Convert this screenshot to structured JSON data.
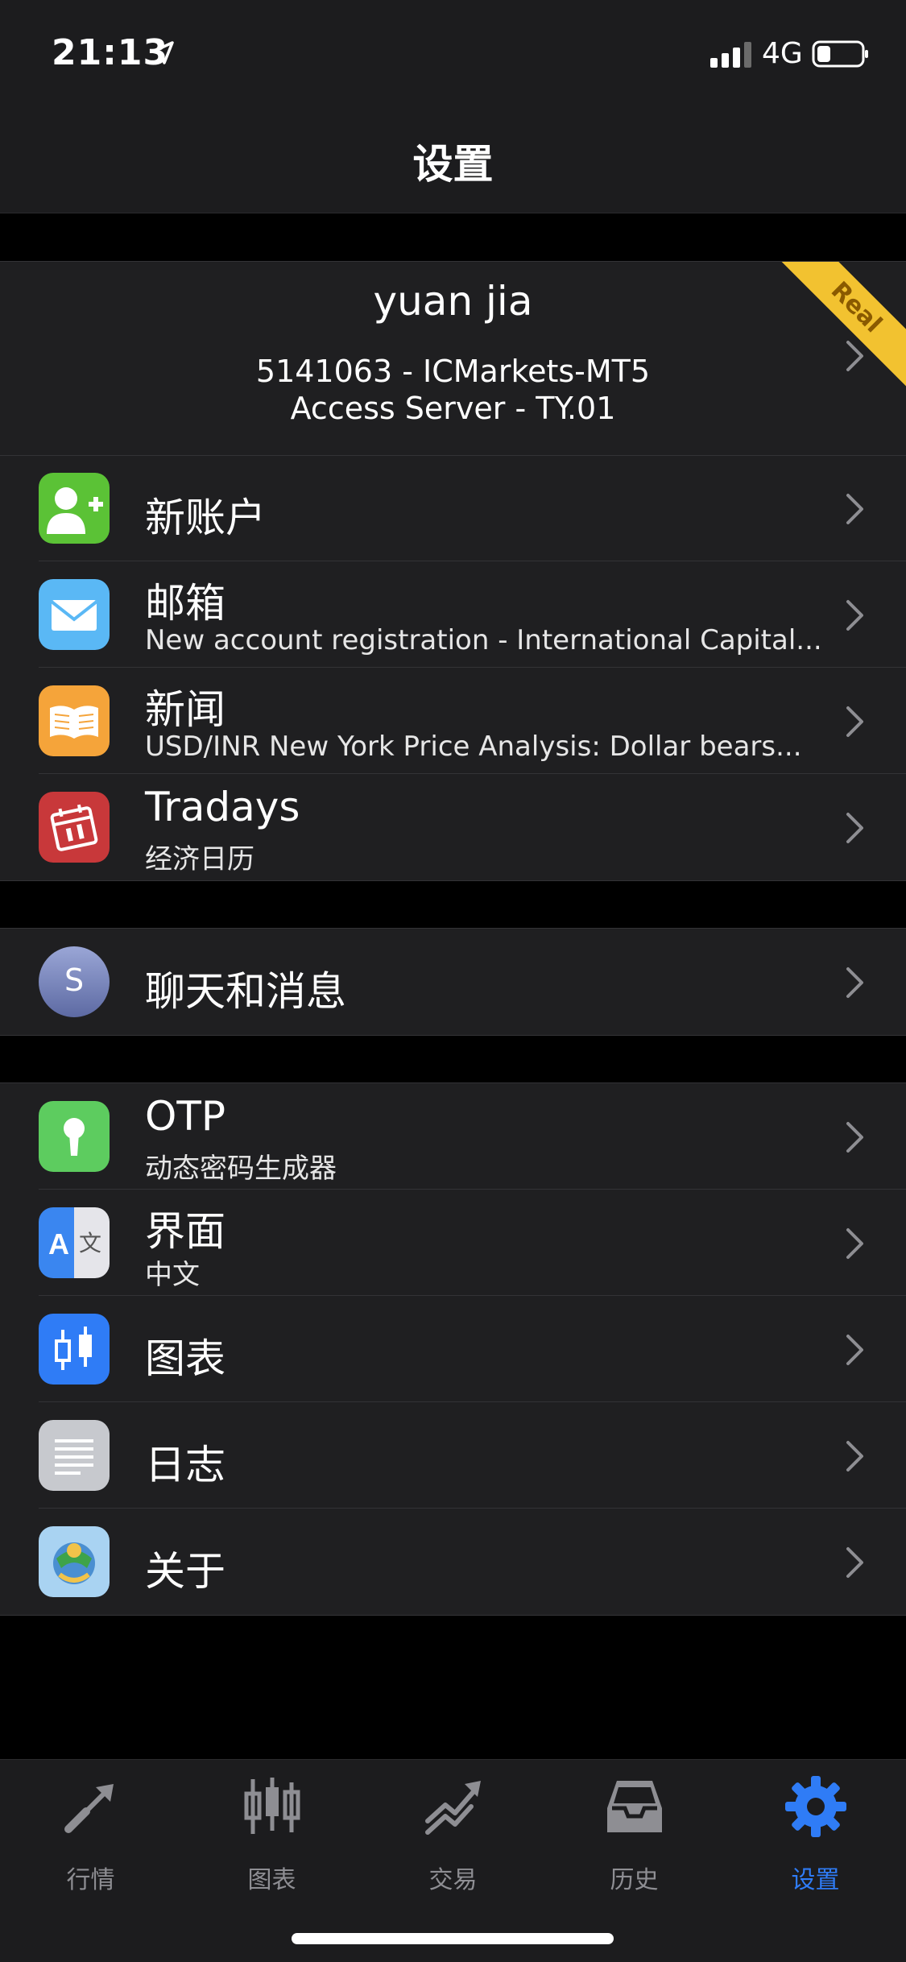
{
  "status": {
    "time": "21:13",
    "network": "4G"
  },
  "nav": {
    "title": "设置"
  },
  "account": {
    "name": "yuan jia",
    "line1": "5141063 - ICMarkets-MT5",
    "line2": "Access Server - TY.01",
    "badge": "Real"
  },
  "group1": [
    {
      "title": "新账户",
      "subtitle": "",
      "icon": "add-user-icon",
      "color": "#5bc236"
    },
    {
      "title": "邮箱",
      "subtitle": "New account registration - International Capital...",
      "icon": "mail-icon",
      "color": "#5ab8f5"
    },
    {
      "title": "新闻",
      "subtitle": "USD/INR New York Price Analysis: Dollar bears...",
      "icon": "book-icon",
      "color": "#f5a43a"
    },
    {
      "title": "Tradays",
      "subtitle": "经济日历",
      "icon": "calendar-icon",
      "color": "#c8383a"
    }
  ],
  "chat": {
    "title": "聊天和消息",
    "avatar_letter": "S"
  },
  "group3": [
    {
      "title": "OTP",
      "subtitle": "动态密码生成器",
      "icon": "key-icon",
      "color": "#5dcc5f"
    },
    {
      "title": "界面",
      "subtitle": "中文",
      "icon": "translate-icon",
      "color": "#3a86f0"
    },
    {
      "title": "图表",
      "subtitle": "",
      "icon": "candlestick-icon",
      "color": "#2f7cf6"
    },
    {
      "title": "日志",
      "subtitle": "",
      "icon": "log-icon",
      "color": "#c7c9ce"
    },
    {
      "title": "关于",
      "subtitle": "",
      "icon": "metatrader-icon",
      "color": "#a9d3f2"
    }
  ],
  "tabs": [
    {
      "label": "行情",
      "icon": "quotes-icon",
      "active": false
    },
    {
      "label": "图表",
      "icon": "chart-icon",
      "active": false
    },
    {
      "label": "交易",
      "icon": "trade-icon",
      "active": false
    },
    {
      "label": "历史",
      "icon": "history-icon",
      "active": false
    },
    {
      "label": "设置",
      "icon": "settings-icon",
      "active": true
    }
  ],
  "colors": {
    "accent": "#2f7cf6",
    "inactive_tab": "#8e8e93",
    "background": "#000000",
    "cell": "#1f1f21"
  }
}
